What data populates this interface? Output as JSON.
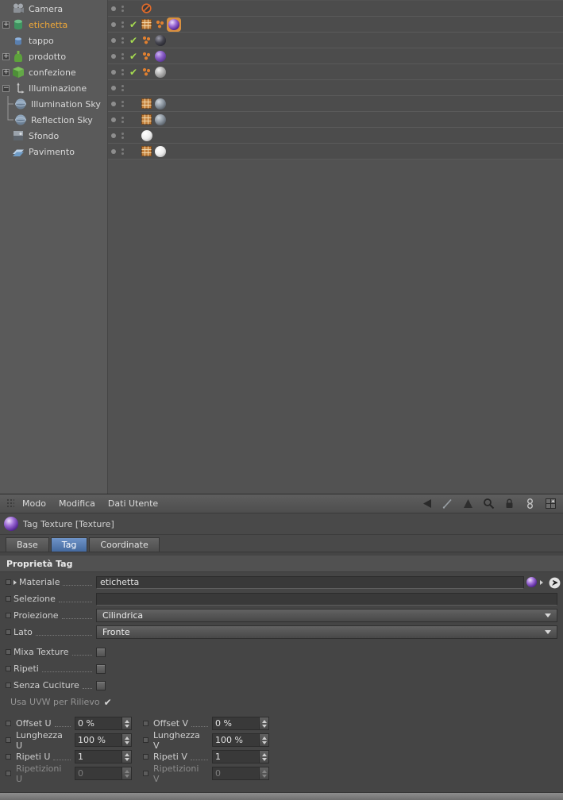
{
  "glyphs": {
    "plus": "+",
    "minus": "−",
    "check": "✔"
  },
  "object_manager": {
    "rows": [
      {
        "name": "Camera"
      },
      {
        "name": "etichetta"
      },
      {
        "name": "tappo"
      },
      {
        "name": "prodotto"
      },
      {
        "name": "confezione"
      },
      {
        "name": "Illuminazione"
      },
      {
        "name": "Illumination Sky"
      },
      {
        "name": "Reflection Sky"
      },
      {
        "name": "Sfondo"
      },
      {
        "name": "Pavimento"
      }
    ]
  },
  "attribute_manager": {
    "menu": [
      "Modo",
      "Modifica",
      "Dati Utente"
    ],
    "title": "Tag Texture [Texture]",
    "tabs": [
      "Base",
      "Tag",
      "Coordinate"
    ],
    "active_tab": "Tag",
    "section_title": "Proprietà Tag",
    "fields": {
      "materiale_label": "Materiale",
      "materiale_value": "etichetta",
      "selezione_label": "Selezione",
      "selezione_value": "",
      "proiezione_label": "Proiezione",
      "proiezione_value": "Cilindrica",
      "lato_label": "Lato",
      "lato_value": "Fronte",
      "mixa_label": "Mixa Texture",
      "ripeti_label": "Ripeti",
      "cuciture_label": "Senza Cuciture",
      "uvw_label": "Usa UVW per Rilievo"
    },
    "grid": [
      {
        "l1": "Offset U",
        "v1": "0 %",
        "l2": "Offset V",
        "v2": "0 %"
      },
      {
        "l1": "Lunghezza U",
        "v1": "100 %",
        "l2": "Lunghezza V",
        "v2": "100 %"
      },
      {
        "l1": "Ripeti U",
        "v1": "1",
        "l2": "Ripeti V",
        "v2": "1"
      },
      {
        "l1": "Ripetizioni U",
        "v1": "0",
        "l2": "Ripetizioni V",
        "v2": "0"
      }
    ]
  },
  "colors": {
    "tab_active": "#44699e",
    "selected_text": "#f0a838",
    "check_green": "#a6dc50"
  }
}
